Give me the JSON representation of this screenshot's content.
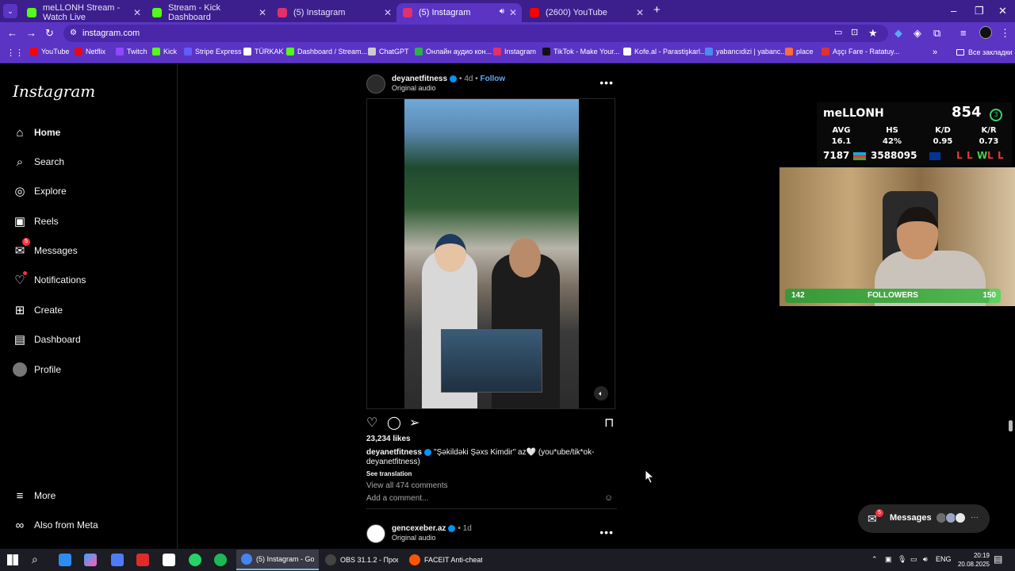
{
  "tabs": [
    {
      "title": "meLLONH Stream - Watch Live",
      "color": "#53fc18"
    },
    {
      "title": "Stream - Kick Dashboard",
      "color": "#53fc18"
    },
    {
      "title": "(5) Instagram",
      "color": "#e1306c"
    },
    {
      "title": "(5) Instagram",
      "color": "#e1306c",
      "active": true
    },
    {
      "title": "(2600) YouTube",
      "color": "#ff0000"
    }
  ],
  "new_tab": "+",
  "address": "instagram.com",
  "bookmarks": [
    {
      "label": "YouTube",
      "color": "#ff0000"
    },
    {
      "label": "Netflix",
      "color": "#e50914"
    },
    {
      "label": "Twitch",
      "color": "#9146ff"
    },
    {
      "label": "Kick",
      "color": "#53fc18"
    },
    {
      "label": "Stripe Express",
      "color": "#635bff"
    },
    {
      "label": "TÜRKAK",
      "color": "#ffffff"
    },
    {
      "label": "Dashboard / Stream...",
      "color": "#53fc18"
    },
    {
      "label": "ChatGPT",
      "color": "#cccccc"
    },
    {
      "label": "Онлайн аудио кон...",
      "color": "#2bb24c"
    },
    {
      "label": "Instagram",
      "color": "#e1306c"
    },
    {
      "label": "TikTok - Make Your...",
      "color": "#111111"
    },
    {
      "label": "Kofe.al - Parastişkarl...",
      "color": "#ffffff"
    },
    {
      "label": "yabancıdizi | yabanc...",
      "color": "#4d8af0"
    },
    {
      "label": "place",
      "color": "#ff6a3d"
    },
    {
      "label": "Aşçı Fare - Ratatuy...",
      "color": "#d33"
    }
  ],
  "bookmarks_more": "»",
  "all_bookmarks": "Все закладки",
  "logo": "Instagram",
  "nav": [
    {
      "label": "Home",
      "icon": "home-icon",
      "glyph": "⌂"
    },
    {
      "label": "Search",
      "icon": "search-icon",
      "glyph": "⌕"
    },
    {
      "label": "Explore",
      "icon": "compass-icon",
      "glyph": "◎"
    },
    {
      "label": "Reels",
      "icon": "reels-icon",
      "glyph": "▣"
    },
    {
      "label": "Messages",
      "icon": "messenger-icon",
      "glyph": "✉",
      "badge": "5"
    },
    {
      "label": "Notifications",
      "icon": "heart-icon",
      "glyph": "♡"
    },
    {
      "label": "Create",
      "icon": "plus-square-icon",
      "glyph": "⊞"
    },
    {
      "label": "Dashboard",
      "icon": "dashboard-icon",
      "glyph": "▤"
    },
    {
      "label": "Profile",
      "icon": "avatar",
      "glyph": "●"
    }
  ],
  "bottom_nav": [
    {
      "label": "More",
      "icon": "menu-icon",
      "glyph": "≡"
    },
    {
      "label": "Also from Meta",
      "icon": "threads-icon",
      "glyph": "∞"
    }
  ],
  "post": {
    "username": "deyanetfitness",
    "time": "4d",
    "follow": "Follow",
    "audio": "Original audio",
    "likes": "23,234 likes",
    "caption_user": "deyanetfitness",
    "caption_text": "\"Şəkildəki Şəxs Kimdir\" az🤍 (you*ube/tik*ok-deyanetfitness)",
    "see_translation": "See translation",
    "view_comments": "View all 474 comments",
    "add_comment": "Add a comment..."
  },
  "next_post": {
    "username": "gencexeber.az",
    "time": "1d",
    "audio": "Original audio"
  },
  "overlay": {
    "name": "meLLONH",
    "elo": "854",
    "level": "3",
    "headers": [
      "AVG",
      "HS",
      "K/D",
      "K/R"
    ],
    "values": [
      "16.1",
      "42%",
      "0.95",
      "0.73"
    ],
    "bottom_left": "7187",
    "bottom_mid": "3588095",
    "results": [
      {
        "r": "L",
        "color": "#e53935"
      },
      {
        "r": "L",
        "color": "#e53935"
      },
      {
        "r": "W",
        "color": "#43d14a"
      },
      {
        "r": "L",
        "color": "#e53935"
      },
      {
        "r": "L",
        "color": "#e53935"
      }
    ],
    "followers_current": "142",
    "followers_label": "FOLLOWERS",
    "followers_goal": "150",
    "followers_progress": 0.947
  },
  "messages_pill": {
    "label": "Messages",
    "badge": "5"
  },
  "taskbar": {
    "windows": [
      {
        "label": "(5) Instagram - Goo...",
        "color": "#4285f4",
        "active": true
      },
      {
        "label": "OBS 31.1.2 - Проф...",
        "color": "#444444"
      },
      {
        "label": "FACEIT Anti-cheat",
        "color": "#ff5500"
      }
    ],
    "lang": "ENG",
    "time": "20:19",
    "date": "20.08.2025"
  }
}
